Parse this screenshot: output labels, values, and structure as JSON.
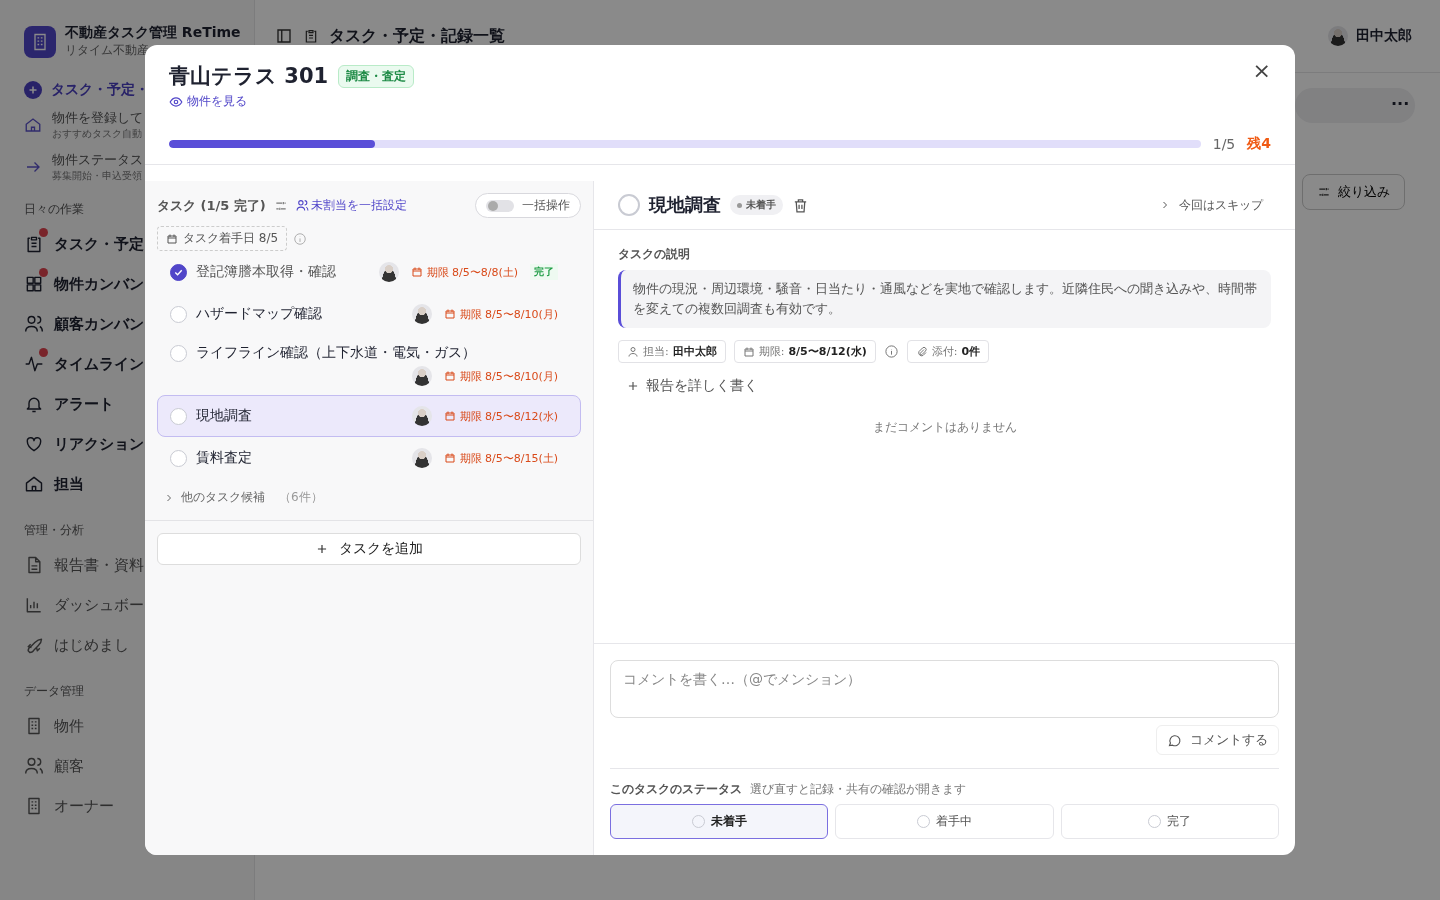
{
  "app": {
    "name": "不動産タスク管理 ReTime",
    "subtitle": "リタイム不動産"
  },
  "sidebar": {
    "primary": "タスク・予定・",
    "promos": [
      {
        "title": "物件を登録して",
        "subtitle": "おすすめタスク自動"
      },
      {
        "title": "物件ステータス",
        "subtitle": "募集開始・申込受領"
      }
    ],
    "sections": [
      {
        "title": "日々の作業",
        "items": [
          {
            "label": "タスク・予定",
            "badge": true
          },
          {
            "label": "物件カンバン",
            "badge": true
          },
          {
            "label": "顧客カンバン",
            "badge": false
          },
          {
            "label": "タイムライン",
            "badge": true
          },
          {
            "label": "アラート",
            "badge": false
          },
          {
            "label": "リアクション",
            "badge": false
          },
          {
            "label": "担当",
            "badge": false
          }
        ]
      },
      {
        "title": "管理・分析",
        "items": [
          {
            "label": "報告書・資料",
            "badge": false
          },
          {
            "label": "ダッシュボー",
            "badge": false
          },
          {
            "label": "はじめまし",
            "badge": false
          }
        ]
      },
      {
        "title": "データ管理",
        "items": [
          {
            "label": "物件",
            "badge": false
          },
          {
            "label": "顧客",
            "badge": false
          },
          {
            "label": "オーナー",
            "badge": false
          }
        ]
      }
    ]
  },
  "topbar": {
    "title": "タスク・予定・記録一覧",
    "user": "田中太郎",
    "filter": "絞り込み",
    "more": "···"
  },
  "modal": {
    "title": "青山テラス 301",
    "tag": "調査・査定",
    "link": "物件を見る",
    "close": "×",
    "progress": {
      "level": 0.2,
      "count": "1/5",
      "remaining": "残4"
    },
    "tasks": {
      "heading": "タスク (1/5 完了)",
      "assign": "未割当を一括設定",
      "bulk": {
        "label": "一括操作",
        "on": false
      },
      "start_date": "タスク着手日 8/5",
      "items": [
        {
          "name": "登記簿謄本取得・確認",
          "due": "期限 8/5〜8/8(土)",
          "done": true,
          "selected": false,
          "badge": "完了"
        },
        {
          "name": "ハザードマップ確認",
          "due": "期限 8/5〜8/10(月)",
          "done": false,
          "selected": false
        },
        {
          "name": "ライフライン確認（上下水道・電気・ガス）",
          "due": "期限 8/5〜8/10(月)",
          "done": false,
          "selected": false
        },
        {
          "name": "現地調査",
          "due": "期限 8/5〜8/12(水)",
          "done": false,
          "selected": true
        },
        {
          "name": "賃料査定",
          "due": "期限 8/5〜8/15(土)",
          "done": false,
          "selected": false
        }
      ],
      "more": {
        "label": "他のタスク候補",
        "count": "（6件）"
      },
      "add": "タスクを追加"
    },
    "detail": {
      "title": "現地調査",
      "done": false,
      "status": "未着手",
      "skip": "今回はスキップ",
      "desc_label": "タスクの説明",
      "description": "物件の現況・周辺環境・騒音・日当たり・通風などを実地で確認します。近隣住民への聞き込みや、時間帯を変えての複数回調査も有効です。",
      "meta": [
        {
          "label": "担当:",
          "value": "田中太郎"
        },
        {
          "label": "期限:",
          "value": "8/5〜8/12(水)"
        },
        {
          "label": "添付:",
          "value": "0件"
        }
      ],
      "report": "報告を詳しく書く",
      "empty": "まだコメントはありません",
      "comment_placeholder": "コメントを書く…（@でメンション）",
      "comment_button": "コメントする",
      "status_label": "このタスクのステータス",
      "status_hint": "選び直すと記録・共有の確認が開きます",
      "statuses": [
        {
          "label": "未着手",
          "selected": true
        },
        {
          "label": "着手中",
          "selected": false
        },
        {
          "label": "完了",
          "selected": false
        }
      ]
    }
  }
}
